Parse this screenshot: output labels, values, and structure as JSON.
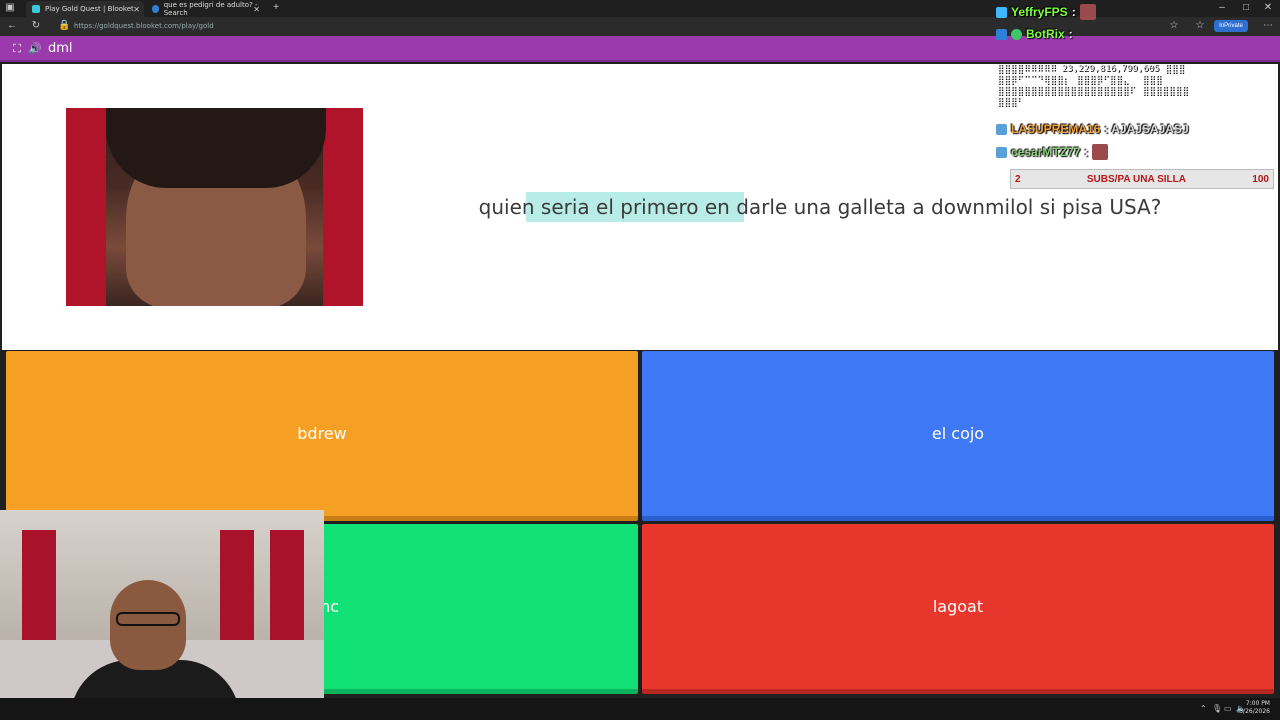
{
  "browser": {
    "tabs": [
      {
        "title": "Play Gold Quest | Blooket",
        "active": true
      },
      {
        "title": "que es pedigri de adulto? - Search",
        "active": false
      }
    ],
    "address": "https://goldquest.blooket.com/play/gold",
    "inprivate": "InPrivate"
  },
  "game": {
    "header_title": "dml",
    "question": "quien seria el primero en darle una galleta a downmilol si pisa USA?",
    "answers": [
      {
        "label": "bdrew",
        "color": "#f5a024"
      },
      {
        "label": "el cojo",
        "color": "#3e78f5"
      },
      {
        "label": "omc",
        "color": "#12e275"
      },
      {
        "label": "lagoat",
        "color": "#e8362d"
      }
    ]
  },
  "chat": {
    "messages": [
      {
        "user": "YeffryFPS",
        "user_color": "#7fff3f",
        "text": ":"
      },
      {
        "user": "BotRix",
        "user_color": "#7fff3f",
        "text": ":"
      },
      {
        "user": "LASUPREMA16",
        "user_color": "#f2a23c",
        "text": ": AJAJSAJASJ"
      },
      {
        "user": "cesarMTZ77",
        "user_color": "#8fd17f",
        "text": ":"
      }
    ],
    "ascii_art": "⣿⣿⣿⣿⠿⠿⠿⠿⠿ 23,229,816,799,605 ⣿⣿⣿\n⣿⣿⡿⠋⠉⠉⠙⢿⣿⣿⡆⠀⣿⣿⣿⡿⠋⣿⣿⣄⠀⠀⣿⣿⣿\n⣿⣿⣿⣿⣿⣿⣿⣿⣿⣿⣿⣿⣿⣿⣿⣿⣿⣿⣿⣿⠏⠀⣿⣿⣿⣿⣿⣿⣿\n⣿⣿⣿⠃",
    "goal": {
      "left": "2",
      "center": "SUBS/PA UNA SILLA",
      "right": "100"
    }
  },
  "taskbar": {
    "time": "7:00 PM",
    "date": "3/26/2026"
  }
}
